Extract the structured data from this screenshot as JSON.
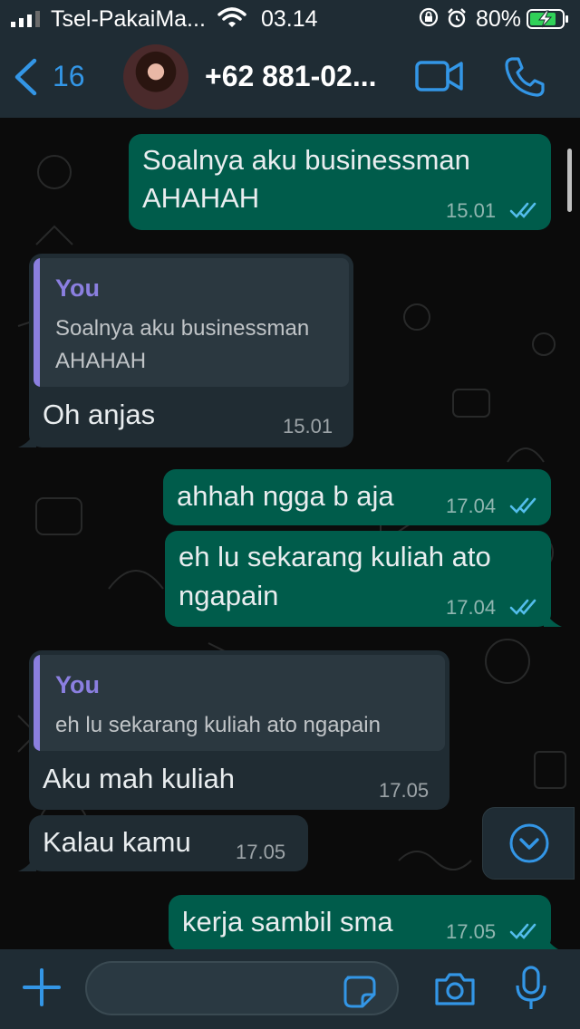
{
  "status_bar": {
    "carrier": "Tsel-PakaiMa...",
    "time": "03.14",
    "battery": "80%"
  },
  "header": {
    "back_count": "16",
    "contact_name": "+62 881-02..."
  },
  "messages": [
    {
      "direction": "out",
      "lines": [
        "Soalnya aku businessman",
        "AHAHAH"
      ],
      "time": "15.01",
      "status": "read"
    },
    {
      "direction": "in",
      "quote": {
        "author": "You",
        "lines": [
          "Soalnya aku businessman",
          "AHAHAH"
        ]
      },
      "lines": [
        "Oh anjas"
      ],
      "time": "15.01"
    },
    {
      "direction": "out",
      "lines": [
        "ahhah ngga b aja"
      ],
      "time": "17.04",
      "status": "read"
    },
    {
      "direction": "out",
      "lines": [
        "eh lu sekarang kuliah ato",
        "ngapain"
      ],
      "time": "17.04",
      "status": "read"
    },
    {
      "direction": "in",
      "quote": {
        "author": "You",
        "lines": [
          "eh lu sekarang kuliah ato ngapain"
        ]
      },
      "lines": [
        "Aku mah kuliah"
      ],
      "time": "17.05"
    },
    {
      "direction": "in",
      "lines": [
        "Kalau kamu"
      ],
      "time": "17.05"
    },
    {
      "direction": "out",
      "lines": [
        "kerja sambil sma"
      ],
      "time": "17.05",
      "status": "read"
    }
  ],
  "composer": {
    "message_value": ""
  },
  "colors": {
    "accent": "#3396e6",
    "outgoing_bubble": "#005c4b",
    "incoming_bubble": "#202c33",
    "quote_author": "#8b7fe0",
    "read_ticks": "#53bdeb"
  }
}
